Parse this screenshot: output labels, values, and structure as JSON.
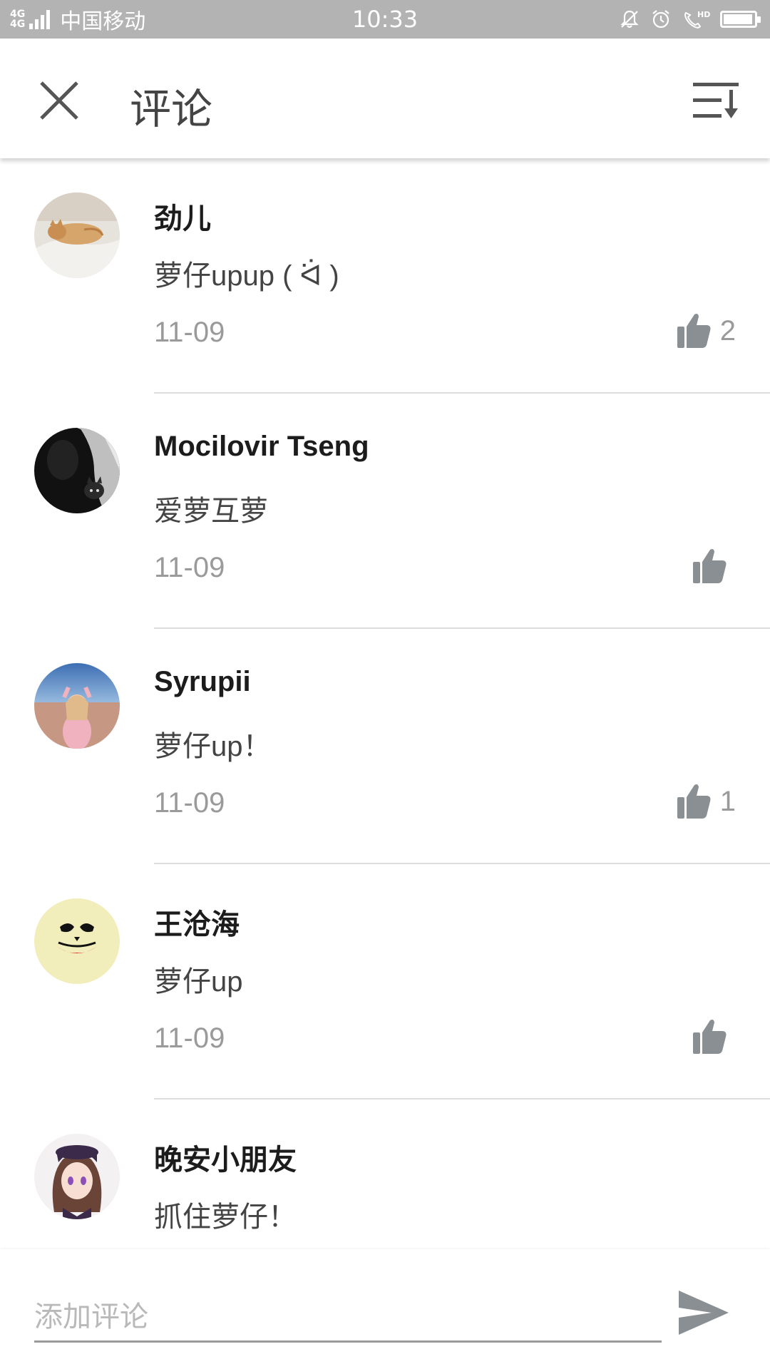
{
  "status_bar": {
    "network_top": "4G",
    "network_bottom": "4G",
    "carrier": "中国移动",
    "time": "10:33",
    "battery_level": 0.95
  },
  "header": {
    "title": "评论",
    "close_icon": "close-icon",
    "sort_icon": "sort-icon"
  },
  "comments": [
    {
      "name": "劲儿",
      "text": "萝仔upup ( ᐛ )",
      "date": "11-09",
      "likes": "2",
      "avatar": "cat-photo-avatar"
    },
    {
      "name": "Mocilovir Tseng",
      "text": "爱萝互萝",
      "date": "11-09",
      "likes": "",
      "avatar": "bw-cat-photo-avatar"
    },
    {
      "name": "Syrupii",
      "text": "萝仔up！",
      "date": "11-09",
      "likes": "1",
      "avatar": "beach-photo-avatar"
    },
    {
      "name": "王沧海",
      "text": "萝仔up",
      "date": "11-09",
      "likes": "",
      "avatar": "joker-avatar"
    },
    {
      "name": "晚安小朋友",
      "text": "抓住萝仔！",
      "date": "",
      "likes": "",
      "avatar": "anime-girl-avatar"
    }
  ],
  "input": {
    "placeholder": "添加评论",
    "value": "",
    "send_icon": "send-icon"
  },
  "colors": {
    "status_bar_bg": "#b3b3b3",
    "icon_gray": "#555555",
    "like_gray": "#8a8f94",
    "meta_text": "#9a9a9a"
  }
}
